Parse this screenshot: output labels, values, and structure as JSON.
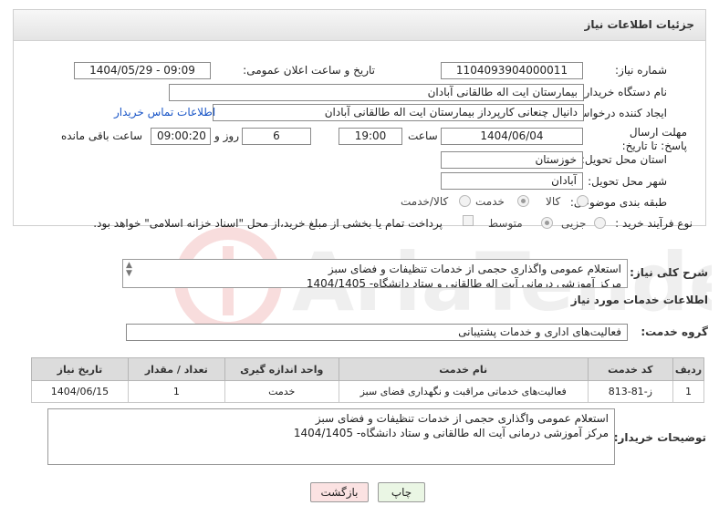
{
  "panel_title": "جزئیات اطلاعات نیاز",
  "need_number": {
    "label": "شماره نیاز:",
    "value": "1104093904000011"
  },
  "announce": {
    "label": "تاریخ و ساعت اعلان عمومی:",
    "value": "1404/05/29 - 09:09"
  },
  "buyer_org": {
    "label": "نام دستگاه خریدار:",
    "value": "بیمارستان ایت اله طالقانی آبادان"
  },
  "creator": {
    "label": "ایجاد کننده درخواست:",
    "value": "دانیال چنعانی کارپرداز بیمارستان ایت اله طالقانی آبادان",
    "contact_link": "اطلاعات تماس خریدار"
  },
  "deadline": {
    "label": "مهلت ارسال پاسخ: تا تاریخ:",
    "date": "1404/06/04",
    "time_label": "ساعت",
    "time": "19:00",
    "days": "6",
    "days_label": "روز و",
    "remaining": "09:00:20",
    "remaining_label": "ساعت باقی مانده"
  },
  "province": {
    "label": "استان محل تحویل:",
    "value": "خوزستان"
  },
  "city": {
    "label": "شهر محل تحویل:",
    "value": "آبادان"
  },
  "category": {
    "label": "طبقه بندی موضوعی:",
    "options": [
      "کالا",
      "خدمت",
      "کالا/خدمت"
    ],
    "selected": "خدمت"
  },
  "process": {
    "label": "نوع فرآیند خرید :",
    "options": [
      "جزیی",
      "متوسط"
    ],
    "selected": "متوسط",
    "payment_note": "پرداخت تمام یا بخشی از مبلغ خرید،از محل \"اسناد خزانه اسلامی\" خواهد بود."
  },
  "general_desc": {
    "label": "شرح کلی نیاز:",
    "lines": [
      "استعلام عمومی واگذاری حجمی از خدمات تنظیفات و فضای سبز",
      "مرکز آموزشی درمانی آیت اله طالقانی  و ستاد دانشگاه- 1404/1405"
    ]
  },
  "services_title": "اطلاعات خدمات مورد نیاز",
  "service_group": {
    "label": "گروه خدمت:",
    "value": "فعالیت‌های اداری و خدمات پشتیبانی"
  },
  "table": {
    "headers": [
      "ردیف",
      "کد خدمت",
      "نام خدمت",
      "واحد اندازه گیری",
      "تعداد / مقدار",
      "تاریخ نیاز"
    ],
    "rows": [
      [
        "1",
        "ز-81-813",
        "فعالیت‌های خدماتی مراقبت و نگهداری فضای سبز",
        "خدمت",
        "1",
        "1404/06/15"
      ]
    ]
  },
  "buyer_notes": {
    "label": "توضیحات خریدار:",
    "lines": [
      "استعلام عمومی واگذاری حجمی از خدمات تنظیفات و فضای سبز",
      "مرکز آموزشی درمانی آیت اله طالقانی  و ستاد دانشگاه- 1404/1405"
    ]
  },
  "buttons": {
    "print": "چاپ",
    "back": "بازگشت"
  },
  "colors": {
    "link": "#1a56c7",
    "print_bg": "#eaf6e4",
    "back_bg": "#fbe2e2"
  }
}
